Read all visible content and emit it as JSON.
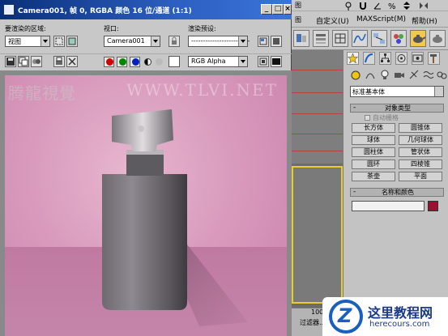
{
  "render_window": {
    "title": "Camera001, 帧 0, RGBA 颜色 16 位/通道 (1:1)",
    "area_label": "要渲染的区域:",
    "area_value": "视图",
    "viewport_label": "视口:",
    "viewport_value": "Camera001",
    "preset_label": "渲染预设:",
    "preset_value": "-------------------------",
    "channel_value": "RGB Alpha",
    "watermark": "腾龍視覺",
    "watermark_url": "WWW.TLVI.NET"
  },
  "max_menu": {
    "item1": "自定义(U)",
    "item2": "MAXScript(M)",
    "item3": "帮助(H)",
    "partial": "图"
  },
  "command_panel": {
    "dropdown_value": "标准基本体",
    "object_type_title": "对象类型",
    "autogrid_label": "自动栅格",
    "primitives": [
      "长方体",
      "圆锥体",
      "球体",
      "几何球体",
      "圆柱体",
      "管状体",
      "圆环",
      "四棱锥",
      "茶壶",
      "平面"
    ],
    "name_color_title": "名称和颜色",
    "name_value": "",
    "object_color": "#9b1030"
  },
  "status": {
    "frame_count": "100",
    "filter_label": "过滤器..."
  },
  "logo": {
    "letter": "Z",
    "name": "这里教程网",
    "url": "herecours.com"
  },
  "colors": {
    "title_bar": "#0a2f78",
    "background_pink": "#d99bbd",
    "red_channel": "#d00000",
    "green_channel": "#008800",
    "blue_channel": "#0020c0",
    "active_tool": "#f2c94c"
  }
}
